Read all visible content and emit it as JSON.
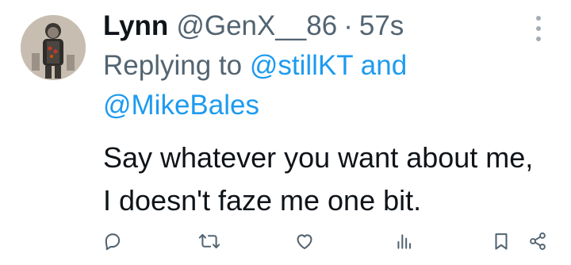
{
  "tweet": {
    "author_name": "Lynn",
    "author_handle": "@GenX__86",
    "separator": "·",
    "time": "57s",
    "replying_prefix": "Replying to",
    "replying_mention_1": "@stillKT",
    "replying_conjunction": "and",
    "replying_mention_2": "@MikeBales",
    "text": "Say whatever you want about me, I doesn't faze me one bit."
  },
  "actions": [
    {
      "name": "reply",
      "icon": "reply-icon"
    },
    {
      "name": "retweet",
      "icon": "retweet-icon"
    },
    {
      "name": "like",
      "icon": "heart-icon"
    },
    {
      "name": "views",
      "icon": "views-icon"
    },
    {
      "name": "bookmark",
      "icon": "bookmark-icon"
    },
    {
      "name": "share",
      "icon": "share-icon"
    }
  ],
  "colors": {
    "text": "#0f1419",
    "secondary": "#536471",
    "link": "#1d9bf0",
    "icon": "#536471"
  }
}
